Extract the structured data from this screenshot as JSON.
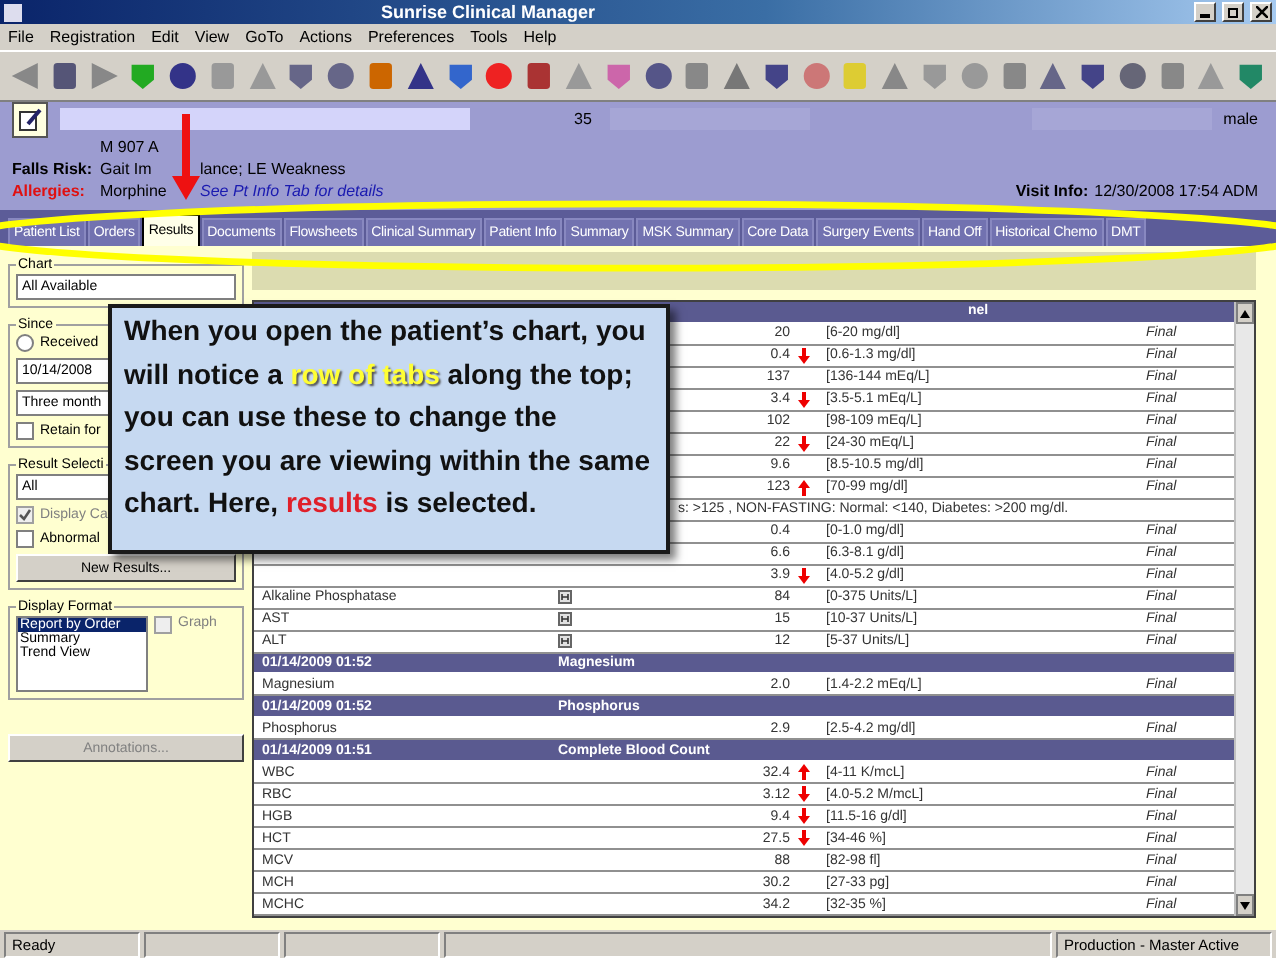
{
  "window": {
    "title": "Sunrise Clinical Manager"
  },
  "menu": [
    "File",
    "Registration",
    "Edit",
    "View",
    "GoTo",
    "Actions",
    "Preferences",
    "Tools",
    "Help"
  ],
  "patient": {
    "location": "M 907 A",
    "age": "35",
    "sex": "male",
    "falls_label": "Falls Risk:",
    "falls_value_start": "Gait Im",
    "falls_value_end": "lance; LE Weakness",
    "allergies_label": "Allergies:",
    "allergies_value": "Morphine",
    "allergies_link": "See Pt Info Tab for details",
    "visit_label": "Visit Info:",
    "visit_value": "12/30/2008 17:54 ADM"
  },
  "tabs": [
    {
      "label": "Patient List",
      "selected": false
    },
    {
      "label": "Orders",
      "selected": false
    },
    {
      "label": "Results",
      "selected": true
    },
    {
      "label": "Documents",
      "selected": false
    },
    {
      "label": "Flowsheets",
      "selected": false
    },
    {
      "label": "Clinical Summary",
      "selected": false
    },
    {
      "label": "Patient Info",
      "selected": false
    },
    {
      "label": "Summary",
      "selected": false
    },
    {
      "label": "MSK Summary",
      "selected": false
    },
    {
      "label": "Core Data",
      "selected": false
    },
    {
      "label": "Surgery Events",
      "selected": false
    },
    {
      "label": "Hand Off",
      "selected": false
    },
    {
      "label": "Historical Chemo",
      "selected": false
    },
    {
      "label": "DMT",
      "selected": false
    }
  ],
  "left_panel": {
    "chart": {
      "legend": "Chart",
      "dropdown": "All Available"
    },
    "since": {
      "legend": "Since",
      "radio": {
        "label": "Received",
        "selected": false
      },
      "date": "10/14/2008",
      "range": "Three month",
      "retain": {
        "label": "Retain for",
        "checked": false
      }
    },
    "result_selection": {
      "legend": "Result Selecti",
      "dropdown": "All",
      "display": {
        "label": "Display Ca",
        "checked": true,
        "disabled": true
      },
      "abnormal": {
        "label": "Abnormal",
        "checked": false,
        "disabled": false
      },
      "button": "New Results..."
    },
    "display_format": {
      "legend": "Display Format",
      "options": [
        {
          "label": "Report by Order",
          "selected": true
        },
        {
          "label": "Summary",
          "selected": false
        },
        {
          "label": "Trend View",
          "selected": false
        }
      ],
      "graph": {
        "label": "Graph",
        "checked": false,
        "disabled": true
      }
    },
    "annotations_button": {
      "label": "Annotations...",
      "disabled": true
    }
  },
  "results": [
    {
      "kind": "group_partial",
      "title": "nel"
    },
    {
      "kind": "result",
      "note": false,
      "value": "20",
      "high": false,
      "low": false,
      "range": "[6-20 mg/dl]",
      "status": "Final"
    },
    {
      "kind": "result",
      "note": false,
      "value": "0.4",
      "high": false,
      "low": true,
      "range": "[0.6-1.3 mg/dl]",
      "status": "Final"
    },
    {
      "kind": "result",
      "note": false,
      "value": "137",
      "high": false,
      "low": false,
      "range": "[136-144 mEq/L]",
      "status": "Final"
    },
    {
      "kind": "result",
      "note": false,
      "value": "3.4",
      "high": false,
      "low": true,
      "range": "[3.5-5.1 mEq/L]",
      "status": "Final"
    },
    {
      "kind": "result",
      "note": false,
      "value": "102",
      "high": false,
      "low": false,
      "range": "[98-109 mEq/L]",
      "status": "Final"
    },
    {
      "kind": "result",
      "note": false,
      "value": "22",
      "high": false,
      "low": true,
      "range": "[24-30 mEq/L]",
      "status": "Final"
    },
    {
      "kind": "result",
      "note": false,
      "value": "9.6",
      "high": false,
      "low": false,
      "range": "[8.5-10.5 mg/dl]",
      "status": "Final"
    },
    {
      "kind": "result",
      "note": false,
      "value": "123",
      "high": true,
      "low": false,
      "range": "[70-99 mg/dl]",
      "status": "Final"
    },
    {
      "kind": "comment",
      "text": "s: >125 , NON-FASTING: Normal: <140, Diabetes: >200 mg/dl."
    },
    {
      "kind": "result",
      "note": false,
      "value": "0.4",
      "high": false,
      "low": false,
      "range": "[0-1.0 mg/dl]",
      "status": "Final"
    },
    {
      "kind": "result",
      "note": false,
      "value": "6.6",
      "high": false,
      "low": false,
      "range": "[6.3-8.1 g/dl]",
      "status": "Final"
    },
    {
      "kind": "result",
      "note": false,
      "value": "3.9",
      "high": false,
      "low": true,
      "range": "[4.0-5.2 g/dl]",
      "status": "Final"
    },
    {
      "kind": "result",
      "name": "Alkaline Phosphatase",
      "note": true,
      "value": "84",
      "high": false,
      "low": false,
      "range": "[0-375 Units/L]",
      "status": "Final"
    },
    {
      "kind": "result",
      "name": "AST",
      "note": true,
      "value": "15",
      "high": false,
      "low": false,
      "range": "[10-37 Units/L]",
      "status": "Final"
    },
    {
      "kind": "result",
      "name": "ALT",
      "note": true,
      "value": "12",
      "high": false,
      "low": false,
      "range": "[5-37 Units/L]",
      "status": "Final"
    },
    {
      "kind": "group",
      "date": "01/14/2009 01:52",
      "title": "Magnesium"
    },
    {
      "kind": "result",
      "name": "Magnesium",
      "note": false,
      "value": "2.0",
      "high": false,
      "low": false,
      "range": "[1.4-2.2 mEq/L]",
      "status": "Final"
    },
    {
      "kind": "group",
      "date": "01/14/2009 01:52",
      "title": "Phosphorus"
    },
    {
      "kind": "result",
      "name": "Phosphorus",
      "note": false,
      "value": "2.9",
      "high": false,
      "low": false,
      "range": "[2.5-4.2 mg/dl]",
      "status": "Final"
    },
    {
      "kind": "group",
      "date": "01/14/2009 01:51",
      "title": "Complete Blood Count"
    },
    {
      "kind": "result",
      "name": "WBC",
      "note": false,
      "value": "32.4",
      "high": true,
      "low": false,
      "range": "[4-11 K/mcL]",
      "status": "Final"
    },
    {
      "kind": "result",
      "name": "RBC",
      "note": false,
      "value": "3.12",
      "high": false,
      "low": true,
      "range": "[4.0-5.2 M/mcL]",
      "status": "Final"
    },
    {
      "kind": "result",
      "name": "HGB",
      "note": false,
      "value": "9.4",
      "high": false,
      "low": true,
      "range": "[11.5-16 g/dl]",
      "status": "Final"
    },
    {
      "kind": "result",
      "name": "HCT",
      "note": false,
      "value": "27.5",
      "high": false,
      "low": true,
      "range": "[34-46 %]",
      "status": "Final"
    },
    {
      "kind": "result",
      "name": "MCV",
      "note": false,
      "value": "88",
      "high": false,
      "low": false,
      "range": "[82-98 fl]",
      "status": "Final"
    },
    {
      "kind": "result",
      "name": "MCH",
      "note": false,
      "value": "30.2",
      "high": false,
      "low": false,
      "range": "[27-33 pg]",
      "status": "Final"
    },
    {
      "kind": "result",
      "name": "MCHC",
      "note": false,
      "value": "34.2",
      "high": false,
      "low": false,
      "range": "[32-35 %]",
      "status": "Final"
    }
  ],
  "callout": [
    {
      "kind": "normal",
      "text": "When you open the patient’s chart, you will notice a "
    },
    {
      "kind": "highlight",
      "text": "row of tabs"
    },
    {
      "kind": "normal",
      "text": " along the top; you can use these to change the screen you are viewing within the same chart. Here, "
    },
    {
      "kind": "emphasis",
      "text": "results"
    },
    {
      "kind": "normal",
      "text": " is selected."
    }
  ],
  "status_bar": {
    "left": "Ready",
    "right": "Production - Master Active"
  }
}
